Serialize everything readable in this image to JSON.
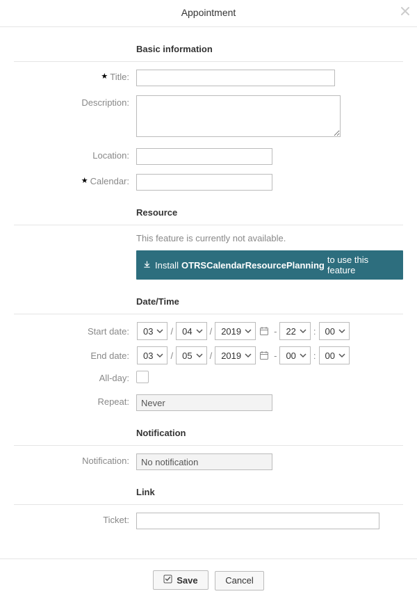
{
  "dialog": {
    "title": "Appointment"
  },
  "sections": {
    "basic": "Basic information",
    "resource": "Resource",
    "datetime": "Date/Time",
    "notification": "Notification",
    "link": "Link"
  },
  "labels": {
    "title": "Title:",
    "description": "Description:",
    "location": "Location:",
    "calendar": "Calendar:",
    "start_date": "Start date:",
    "end_date": "End date:",
    "all_day": "All-day:",
    "repeat": "Repeat:",
    "notification": "Notification:",
    "ticket": "Ticket:"
  },
  "values": {
    "title": "",
    "description": "",
    "location": "",
    "calendar": "",
    "start": {
      "month": "03",
      "day": "04",
      "year": "2019",
      "hour": "22",
      "minute": "00"
    },
    "end": {
      "month": "03",
      "day": "05",
      "year": "2019",
      "hour": "00",
      "minute": "00"
    },
    "all_day": false,
    "repeat": "Never",
    "notification": "No notification",
    "ticket": ""
  },
  "separators": {
    "slash": "/",
    "dash": "-",
    "colon": ":"
  },
  "resource": {
    "note": "This feature is currently not available.",
    "banner_prefix": "Install",
    "banner_package": "OTRSCalendarResourcePlanning",
    "banner_suffix": "to use this feature"
  },
  "buttons": {
    "save": "Save",
    "cancel": "Cancel"
  },
  "icons": {
    "close": "close-icon",
    "chevron_down": "chevron-down-icon",
    "calendar": "calendar-icon",
    "download": "download-icon",
    "check": "check-icon",
    "required": "required-icon"
  }
}
